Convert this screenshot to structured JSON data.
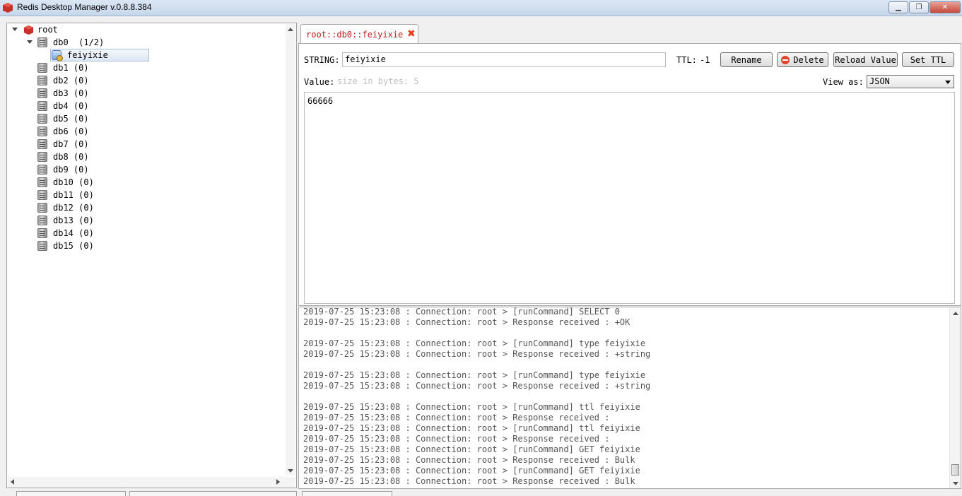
{
  "window": {
    "title": "Redis Desktop Manager v.0.8.8.384",
    "minimize_glyph": "▁",
    "maximize_glyph": "❐",
    "close_glyph": "✕"
  },
  "tree": {
    "root_label": "root",
    "db0_label": "db0  (1/2)",
    "selected_key": "feiyixie",
    "databases": [
      "db1 (0)",
      "db2 (0)",
      "db3 (0)",
      "db4 (0)",
      "db5 (0)",
      "db6 (0)",
      "db7 (0)",
      "db8 (0)",
      "db9 (0)",
      "db10 (0)",
      "db11 (0)",
      "db12 (0)",
      "db13 (0)",
      "db14 (0)",
      "db15 (0)"
    ]
  },
  "tab": {
    "label": "root::db0::feiyixie",
    "close_glyph": "✖"
  },
  "editor": {
    "type_label": "STRING:",
    "key_value": "feiyixie",
    "ttl_label": "TTL:",
    "ttl_value": "-1",
    "rename_label": "Rename",
    "delete_label": "Delete",
    "reload_label": "Reload Value",
    "set_ttl_label": "Set TTL",
    "value_label": "Value:",
    "size_hint": "size in bytes: 5",
    "view_as_label": "View as:",
    "view_as_selected": "JSON",
    "value_content": "66666"
  },
  "log": {
    "lines": [
      "2019-07-25 15:23:08 : Connection: root > [runCommand] SELECT 0",
      "2019-07-25 15:23:08 : Connection: root > Response received : +OK",
      "",
      "2019-07-25 15:23:08 : Connection: root > [runCommand] type feiyixie",
      "2019-07-25 15:23:08 : Connection: root > Response received : +string",
      "",
      "2019-07-25 15:23:08 : Connection: root > [runCommand] type feiyixie",
      "2019-07-25 15:23:08 : Connection: root > Response received : +string",
      "",
      "2019-07-25 15:23:08 : Connection: root > [runCommand] ttl feiyixie",
      "2019-07-25 15:23:08 : Connection: root > Response received :",
      "2019-07-25 15:23:08 : Connection: root > [runCommand] ttl feiyixie",
      "2019-07-25 15:23:08 : Connection: root > Response received :",
      "2019-07-25 15:23:08 : Connection: root > [runCommand] GET feiyixie",
      "2019-07-25 15:23:08 : Connection: root > Response received : Bulk",
      "2019-07-25 15:23:08 : Connection: root > [runCommand] GET feiyixie",
      "2019-07-25 15:23:08 : Connection: root > Response received : Bulk"
    ]
  },
  "colors": {
    "tab_text": "#c02020",
    "redis_red": "#c8302a",
    "log_text": "#555555"
  }
}
